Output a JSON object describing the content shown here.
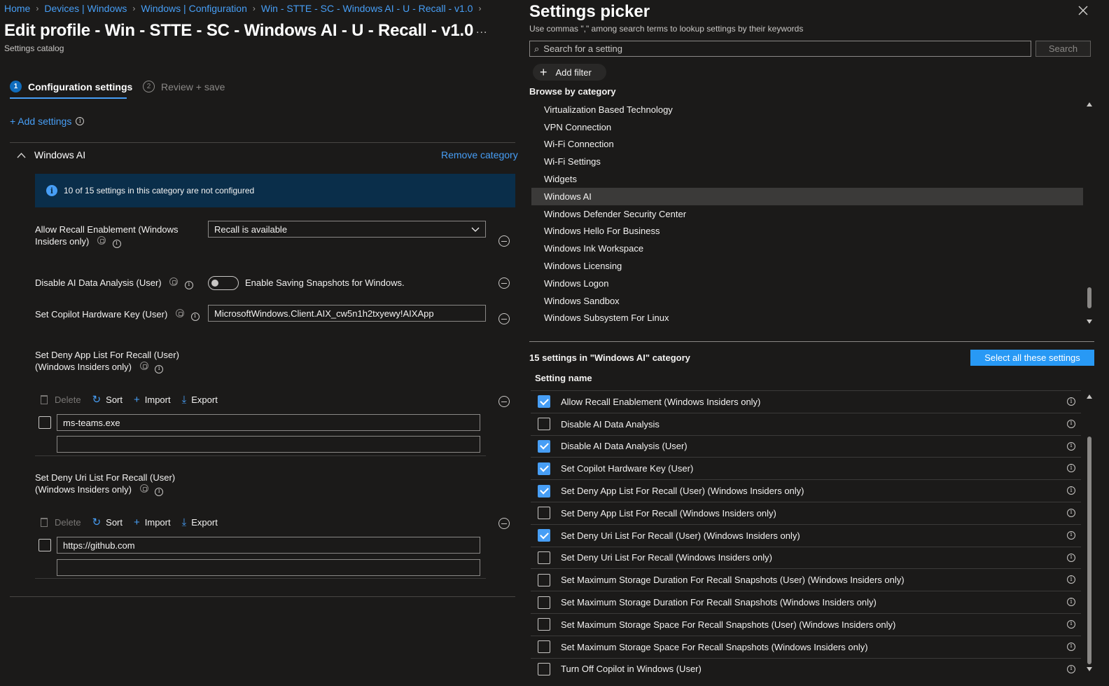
{
  "breadcrumb": [
    "Home",
    "Devices | Windows",
    "Windows | Configuration",
    "Win - STTE - SC - Windows AI - U - Recall - v1.0"
  ],
  "page": {
    "title": "Edit profile - Win - STTE - SC - Windows AI - U - Recall - v1.0",
    "subtitle": "Settings catalog",
    "more": "..."
  },
  "wizard": {
    "step1": {
      "num": "1",
      "label": "Configuration settings"
    },
    "step2": {
      "num": "2",
      "label": "Review + save"
    }
  },
  "add_settings": "+ Add settings",
  "category": {
    "name": "Windows AI",
    "remove": "Remove category",
    "banner": "10 of 15 settings in this category are not configured"
  },
  "settings": {
    "recall_enablement": {
      "label": "Allow Recall Enablement (Windows Insiders only)",
      "value": "Recall is available"
    },
    "disable_ai": {
      "label": "Disable AI Data Analysis (User)",
      "toggle_text": "Enable Saving Snapshots for Windows.",
      "toggle_on": false
    },
    "copilot_key": {
      "label": "Set Copilot Hardware Key (User)",
      "value": "MicrosoftWindows.Client.AIX_cw5n1h2txyewy!AIXApp"
    },
    "deny_app": {
      "label": "Set Deny App List For Recall (User) (Windows Insiders only)",
      "items": [
        "ms-teams.exe"
      ]
    },
    "deny_uri": {
      "label": "Set Deny Uri List For Recall (User) (Windows Insiders only)",
      "items": [
        "https://github.com"
      ]
    }
  },
  "toolbar": {
    "delete": "Delete",
    "sort": "Sort",
    "import": "Import",
    "export": "Export"
  },
  "picker": {
    "title": "Settings picker",
    "hint": "Use commas \",\" among search terms to lookup settings by their keywords",
    "search_placeholder": "Search for a setting",
    "search_button": "Search",
    "add_filter": "Add filter",
    "browse_label": "Browse by category",
    "categories": [
      "Virtualization Based Technology",
      "VPN Connection",
      "Wi-Fi Connection",
      "Wi-Fi Settings",
      "Widgets",
      "Windows AI",
      "Windows Defender Security Center",
      "Windows Hello For Business",
      "Windows Ink Workspace",
      "Windows Licensing",
      "Windows Logon",
      "Windows Sandbox",
      "Windows Subsystem For Linux"
    ],
    "selected_category_index": 5,
    "count_label": "15 settings in \"Windows AI\" category",
    "select_all": "Select all these settings",
    "column_header": "Setting name",
    "settings": [
      {
        "name": "Allow Recall Enablement (Windows Insiders only)",
        "checked": true
      },
      {
        "name": "Disable AI Data Analysis",
        "checked": false
      },
      {
        "name": "Disable AI Data Analysis (User)",
        "checked": true
      },
      {
        "name": "Set Copilot Hardware Key (User)",
        "checked": true
      },
      {
        "name": "Set Deny App List For Recall (User) (Windows Insiders only)",
        "checked": true
      },
      {
        "name": "Set Deny App List For Recall (Windows Insiders only)",
        "checked": false
      },
      {
        "name": "Set Deny Uri List For Recall (User) (Windows Insiders only)",
        "checked": true
      },
      {
        "name": "Set Deny Uri List For Recall (Windows Insiders only)",
        "checked": false
      },
      {
        "name": "Set Maximum Storage Duration For Recall Snapshots (User) (Windows Insiders only)",
        "checked": false
      },
      {
        "name": "Set Maximum Storage Duration For Recall Snapshots (Windows Insiders only)",
        "checked": false
      },
      {
        "name": "Set Maximum Storage Space For Recall Snapshots (User) (Windows Insiders only)",
        "checked": false
      },
      {
        "name": "Set Maximum Storage Space For Recall Snapshots (Windows Insiders only)",
        "checked": false
      },
      {
        "name": "Turn Off Copilot in Windows (User)",
        "checked": false
      }
    ]
  },
  "colors": {
    "accent": "#479ef5",
    "button_primary": "#2899f5",
    "background": "#1b1a19",
    "banner": "#0a2e4a"
  }
}
